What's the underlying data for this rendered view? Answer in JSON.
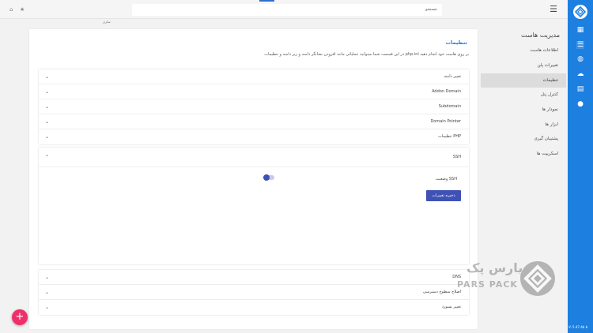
{
  "header": {
    "search_text": "جستجو",
    "sub_label": "سازی"
  },
  "sidebar": {
    "title": "مدیریت هاست",
    "items": [
      {
        "label": "اطلاعات هاست"
      },
      {
        "label": "تغییرات پلن"
      },
      {
        "label": "تنظیمات"
      },
      {
        "label": "کنترل پنل"
      },
      {
        "label": "نمودار ها"
      },
      {
        "label": "ابزار ها"
      },
      {
        "label": "پشتیبان گیری"
      },
      {
        "label": "اسکریپت ها"
      }
    ]
  },
  "main": {
    "title": "تنظیمات",
    "description": "در این قسمت شما میتوانید عملیاتی مانند افزودن نشانگر دامنه و زیر دامنه و تنظیمات php.ini بر روی هاست خود انجام دهید",
    "group1": [
      {
        "label": "تغییر دامنه"
      },
      {
        "label": "Addon Domain"
      },
      {
        "label": "Subdomain"
      },
      {
        "label": "Domain Pointer"
      },
      {
        "label": "تنظیمات PHP"
      }
    ],
    "ssh": {
      "label": "SSH",
      "status_label": "وضعیت SSH",
      "save_label": "ذخیره تغییرات"
    },
    "group2": [
      {
        "label": "DNS"
      },
      {
        "label": "اصلاح سطوح دسترسی"
      },
      {
        "label": "تغییر پسورد"
      }
    ]
  },
  "version": "V: 5.47.4b b",
  "watermark": {
    "fa": "پارس پک",
    "en": "PARS PACK"
  },
  "colors": {
    "accent": "#1d7fe0",
    "button": "#3f51b5",
    "fab": "#f0306b"
  }
}
